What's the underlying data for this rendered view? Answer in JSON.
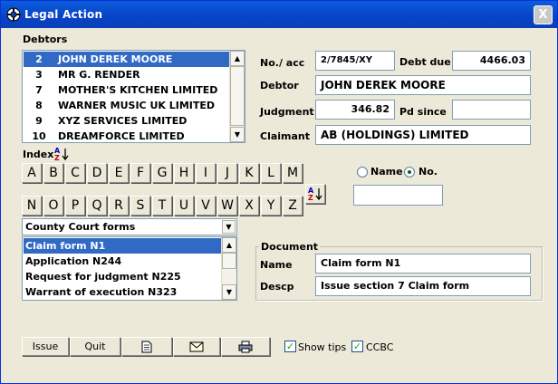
{
  "window": {
    "title": "Legal Action",
    "close_label": "X"
  },
  "debtors": {
    "label": "Debtors",
    "rows": [
      {
        "num": "2",
        "name": "JOHN DEREK MOORE",
        "selected": true
      },
      {
        "num": "3",
        "name": "MR G. RENDER"
      },
      {
        "num": "7",
        "name": "MOTHER'S KITCHEN LIMITED"
      },
      {
        "num": "8",
        "name": "WARNER MUSIC UK LIMITED"
      },
      {
        "num": "9",
        "name": "XYZ SERVICES LIMITED"
      },
      {
        "num": "10",
        "name": "DREAMFORCE LIMITED"
      }
    ]
  },
  "details": {
    "acc_label": "No./ acc",
    "acc_value": "2/7845/XY",
    "debt_due_label": "Debt due",
    "debt_due_value": "4466.03",
    "debtor_label": "Debtor",
    "debtor_value": "JOHN DEREK MOORE",
    "judgment_label": "Judgment",
    "judgment_value": "346.82",
    "pd_since_label": "Pd since",
    "pd_since_value": "",
    "claimant_label": "Claimant",
    "claimant_value": "AB (HOLDINGS) LIMITED"
  },
  "index": {
    "label": "Index",
    "row1": [
      "A",
      "B",
      "C",
      "D",
      "E",
      "F",
      "G",
      "H",
      "I",
      "J",
      "K",
      "L",
      "M"
    ],
    "row2": [
      "N",
      "O",
      "P",
      "Q",
      "R",
      "S",
      "T",
      "U",
      "V",
      "W",
      "X",
      "Y",
      "Z"
    ],
    "radio_name_label": "Name",
    "radio_no_label": "No.",
    "selected_radio": "No.",
    "search_value": ""
  },
  "forms": {
    "combo_value": "County Court forms",
    "items": [
      {
        "label": "Claim form N1",
        "selected": true
      },
      {
        "label": "Application N244"
      },
      {
        "label": "Request for judgment N225"
      },
      {
        "label": "Warrant of execution N323"
      }
    ]
  },
  "document": {
    "group_label": "Document",
    "name_label": "Name",
    "name_value": "Claim form N1",
    "descp_label": "Descp",
    "descp_value": "Issue section 7 Claim form"
  },
  "toolbar": {
    "issue_label": "Issue",
    "quit_label": "Quit",
    "show_tips_label": "Show tips",
    "ccbc_label": "CCBC",
    "show_tips_checked": true,
    "ccbc_checked": true
  },
  "colors": {
    "title_bar": "#0842c6",
    "selection": "#316ac5",
    "face": "#ece9d8",
    "border": "#7f9db9"
  }
}
